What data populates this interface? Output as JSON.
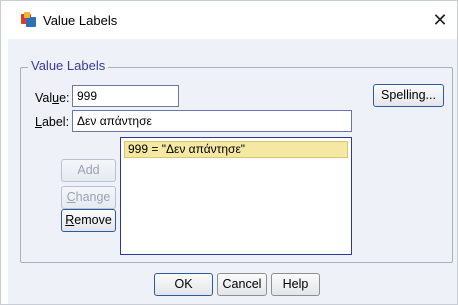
{
  "window": {
    "title": "Value Labels",
    "close_glyph": "✕"
  },
  "group": {
    "label": "Value Labels"
  },
  "value_field": {
    "label_pre": "Val",
    "label_mnemonic": "u",
    "label_post": "e:",
    "value": "999"
  },
  "label_field": {
    "label_mnemonic": "L",
    "label_post": "abel:",
    "value": "Δεν απάντησε"
  },
  "buttons": {
    "spelling": "Spelling...",
    "add": "Add",
    "change_mnemonic": "C",
    "change_post": "hange",
    "remove_mnemonic": "R",
    "remove_post": "emove",
    "ok": "OK",
    "cancel": "Cancel",
    "help": "Help"
  },
  "list": {
    "items": [
      "999 = \"Δεν απάντησε\""
    ],
    "selected_index": 0
  },
  "icons": {
    "app": "spss-app-icon",
    "close": "close-icon"
  }
}
